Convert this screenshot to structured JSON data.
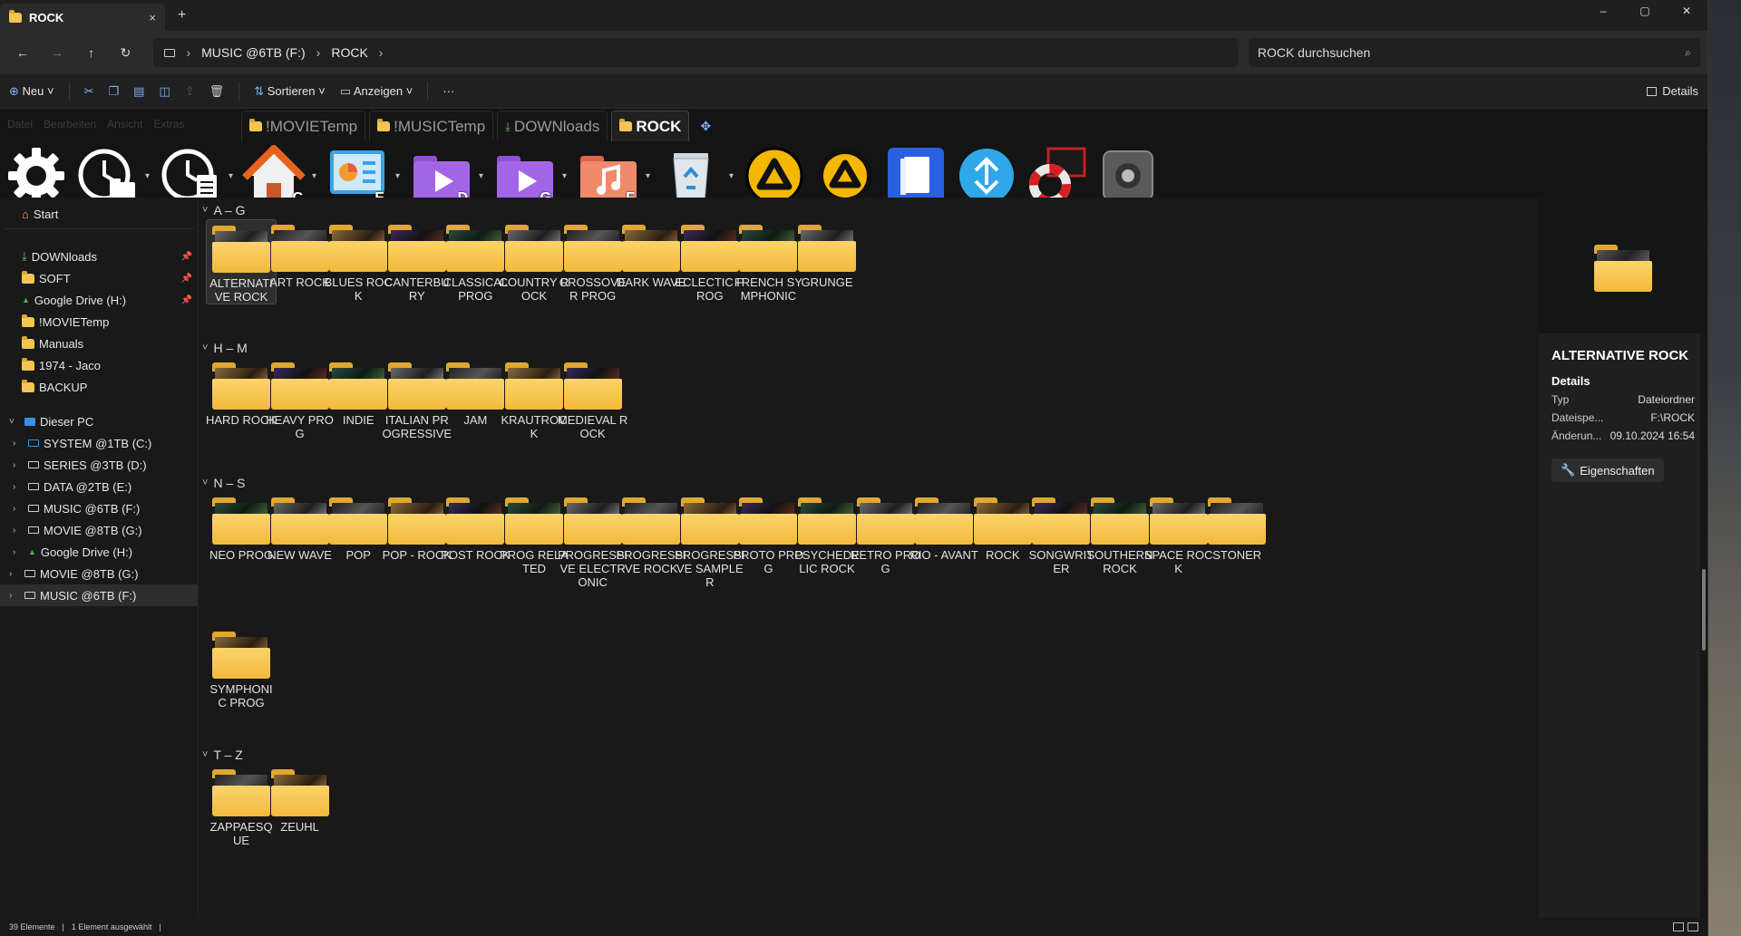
{
  "window": {
    "tab_title": "ROCK",
    "tab_close": "×",
    "new_tab": "+",
    "controls": [
      "–",
      "▢",
      "✕"
    ]
  },
  "address": {
    "back": "←",
    "forward": "→",
    "up": "↑",
    "refresh": "↻",
    "crumbs": [
      "MUSIC @6TB (F:)",
      "ROCK"
    ],
    "search_placeholder": "ROCK durchsuchen"
  },
  "commandbar": {
    "new_label": "Neu",
    "sort_label": "Sortieren",
    "view_label": "Anzeigen",
    "more_label": "···",
    "details_label": "Details"
  },
  "menu_ghost": [
    "Datei",
    "Bearbeiten",
    "Ansicht",
    "Extras"
  ],
  "folder_tabs": [
    {
      "label": "!MOVIETemp",
      "active": false
    },
    {
      "label": "!MUSICTemp",
      "active": false
    },
    {
      "label": "DOWNloads",
      "active": false
    },
    {
      "label": "ROCK",
      "active": true
    }
  ],
  "shortcuts": [
    {
      "icon": "gear-icon",
      "badge": ""
    },
    {
      "icon": "clock-folder-icon",
      "badge": ""
    },
    {
      "icon": "clock-document-icon",
      "badge": ""
    },
    {
      "icon": "home-icon",
      "badge": "C"
    },
    {
      "icon": "presentation-icon",
      "badge": "E"
    },
    {
      "icon": "video-folder-icon",
      "badge": "D"
    },
    {
      "icon": "video-folder-icon",
      "badge": "G"
    },
    {
      "icon": "music-folder-icon",
      "badge": "F"
    },
    {
      "icon": "recycle-bin-icon",
      "badge": ""
    },
    {
      "icon": "aimp-icon",
      "badge": ""
    },
    {
      "icon": "aimp-icon",
      "badge": ""
    },
    {
      "icon": "book-icon",
      "badge": ""
    },
    {
      "icon": "sync-icon",
      "badge": ""
    },
    {
      "icon": "lifebuoy-icon",
      "badge": ""
    },
    {
      "icon": "speaker-icon",
      "badge": ""
    }
  ],
  "sidebar": {
    "start": "Start",
    "pinned": [
      {
        "label": "DOWNloads",
        "icon": "download-icon",
        "pinned": true
      },
      {
        "label": "SOFT",
        "icon": "folder-icon",
        "pinned": true
      },
      {
        "label": "Google Drive (H:)",
        "icon": "google-drive-icon",
        "pinned": true
      },
      {
        "label": "!MOVIETemp",
        "icon": "folder-icon",
        "pinned": false
      },
      {
        "label": "Manuals",
        "icon": "folder-icon",
        "pinned": false
      },
      {
        "label": "1974 - Jaco",
        "icon": "folder-icon",
        "pinned": false
      },
      {
        "label": "BACKUP",
        "icon": "folder-icon",
        "pinned": false
      }
    ],
    "this_pc": "Dieser PC",
    "drives": [
      {
        "label": "SYSTEM @1TB (C:)",
        "icon": "system-drive-icon"
      },
      {
        "label": "SERIES @3TB (D:)",
        "icon": "drive-icon"
      },
      {
        "label": "DATA @2TB (E:)",
        "icon": "drive-icon"
      },
      {
        "label": "MUSIC @6TB (F:)",
        "icon": "drive-icon"
      },
      {
        "label": "MOVIE @8TB (G:)",
        "icon": "drive-icon"
      },
      {
        "label": "Google Drive (H:)",
        "icon": "google-drive-icon"
      }
    ],
    "network": [
      {
        "label": "MOVIE @8TB (G:)",
        "selected": false
      },
      {
        "label": "MUSIC @6TB (F:)",
        "selected": true
      }
    ]
  },
  "groups": [
    {
      "title": "A – G",
      "items": [
        "ALTERNATIVE ROCK",
        "ART ROCK",
        "BLUES ROCK",
        "CANTERBURY",
        "CLASSICAL PROG",
        "COUNTRY ROCK",
        "CROSSOVER PROG",
        "DARK WAVE",
        "ECLECTIC PROG",
        "FRENCH SYMPHONIC",
        "GRUNGE"
      ]
    },
    {
      "title": "H – M",
      "items": [
        "HARD ROCK",
        "HEAVY PROG",
        "INDIE",
        "ITALIAN PROGRESSIVE",
        "JAM",
        "KRAUTROCK",
        "MEDIEVAL ROCK"
      ]
    },
    {
      "title": "N – S",
      "items": [
        "NEO PROG",
        "NEW WAVE",
        "POP",
        "POP - ROCK",
        "POST ROCK",
        "PROG RELATED",
        "PROGRESSIVE ELECTRONIC",
        "PROGRESSIVE ROCK",
        "PROGRESSIVE SAMPLER",
        "PROTO PROG",
        "PSYCHEDELIC ROCK",
        "RETRO PROG",
        "RIO - AVANT",
        "ROCK",
        "SONGWRITER",
        "SOUTHERN ROCK",
        "SPACE ROCK",
        "STONER",
        "SYMPHONIC PROG"
      ]
    },
    {
      "title": "T – Z",
      "items": [
        "ZAPPAESQUE",
        "ZEUHL"
      ]
    }
  ],
  "selected_item": "ALTERNATIVE ROCK",
  "details": {
    "title": "ALTERNATIVE ROCK",
    "section": "Details",
    "rows": [
      {
        "k": "Typ",
        "v": "Dateiordner"
      },
      {
        "k": "Dateispe...",
        "v": "F:\\ROCK"
      },
      {
        "k": "Änderun...",
        "v": "09.10.2024 16:54"
      }
    ],
    "props_label": "Eigenschaften"
  },
  "status": {
    "count": "39 Elemente",
    "selected": "1 Element ausgewählt"
  },
  "colors": {
    "folder": "#f4c550",
    "accent": "#7fb3f5",
    "background": "#191919"
  }
}
